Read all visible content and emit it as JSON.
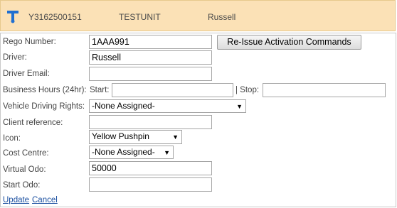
{
  "header": {
    "unit_id": "Y3162500151",
    "unit_name": "TESTUNIT",
    "driver": "Russell",
    "logo_icon": "telstra-logo-icon"
  },
  "form": {
    "rego_label": "Rego Number:",
    "rego_value": "1AAA991",
    "reissue_button": "Re-Issue Activation Commands",
    "driver_label": "Driver:",
    "driver_value": "Russell",
    "driver_email_label": "Driver Email:",
    "driver_email_value": "",
    "business_hours_label": "Business Hours (24hr):",
    "start_label": "Start:",
    "start_value": "",
    "stop_label": "| Stop:",
    "stop_value": "",
    "vehicle_rights_label": "Vehicle Driving Rights:",
    "vehicle_rights_value": "-None Assigned-",
    "client_ref_label": "Client reference:",
    "client_ref_value": "",
    "icon_label": "Icon:",
    "icon_value": "Yellow Pushpin",
    "cost_centre_label": "Cost Centre:",
    "cost_centre_value": "-None Assigned-",
    "virtual_odo_label": "Virtual Odo:",
    "virtual_odo_value": "50000",
    "start_odo_label": "Start Odo:",
    "start_odo_value": ""
  },
  "actions": {
    "update": "Update",
    "cancel": "Cancel"
  },
  "colors": {
    "header_bg": "#fbe1b6",
    "link": "#1a4fa0",
    "logo": "#1f6fd1"
  }
}
